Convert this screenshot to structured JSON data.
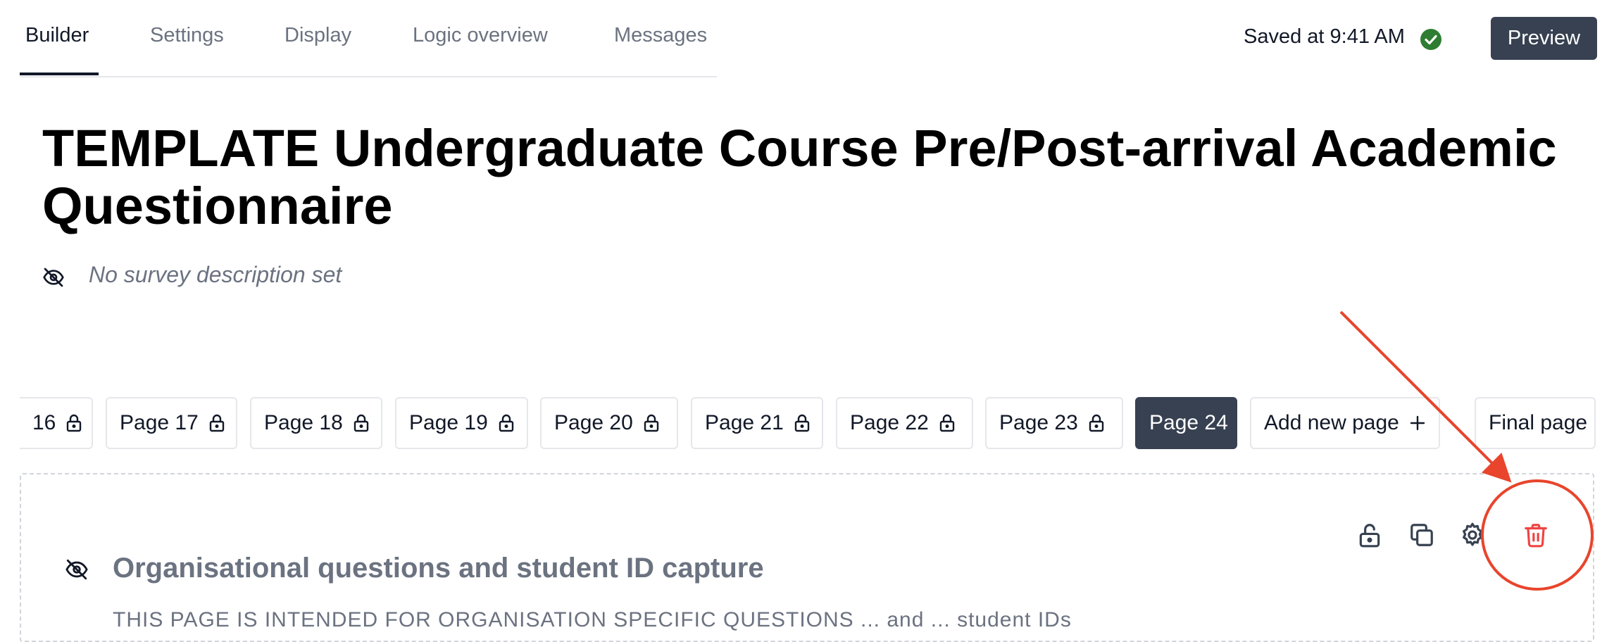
{
  "tabs": [
    "Builder",
    "Settings",
    "Display",
    "Logic overview",
    "Messages"
  ],
  "status": {
    "saved_text": "Saved at 9:41 AM",
    "saved_icon": "check-circle-icon",
    "ok_color": "#2e7d32"
  },
  "preview_label": "Preview",
  "survey": {
    "title": "TEMPLATE Undergraduate Course Pre/Post-arrival Academic Questionnaire",
    "description_placeholder": "No survey description set",
    "description_icon": "eye-off-icon"
  },
  "pages": [
    {
      "label": "16",
      "icon": "lock-icon"
    },
    {
      "label": "Page 17",
      "icon": "lock-icon"
    },
    {
      "label": "Page 18",
      "icon": "lock-icon"
    },
    {
      "label": "Page 19",
      "icon": "lock-icon"
    },
    {
      "label": "Page 20",
      "icon": "lock-icon"
    },
    {
      "label": "Page 21",
      "icon": "lock-icon"
    },
    {
      "label": "Page 22",
      "icon": "lock-icon"
    },
    {
      "label": "Page 23",
      "icon": "lock-icon"
    },
    {
      "label": "Page 24",
      "active": true
    },
    {
      "label": "Add new page",
      "icon": "plus-icon"
    },
    {
      "label": "Final page"
    }
  ],
  "current_page": {
    "title": "Organisational questions and student ID capture",
    "body_excerpt": "THIS PAGE IS INTENDED FOR ORGANISATION SPECIFIC QUESTIONS ... and ... student IDs",
    "actions": [
      "unlock-icon",
      "copy-icon",
      "gear-icon",
      "trash-icon"
    ],
    "delete_color": "#ef4444"
  },
  "annotation_color": "#e8452c"
}
